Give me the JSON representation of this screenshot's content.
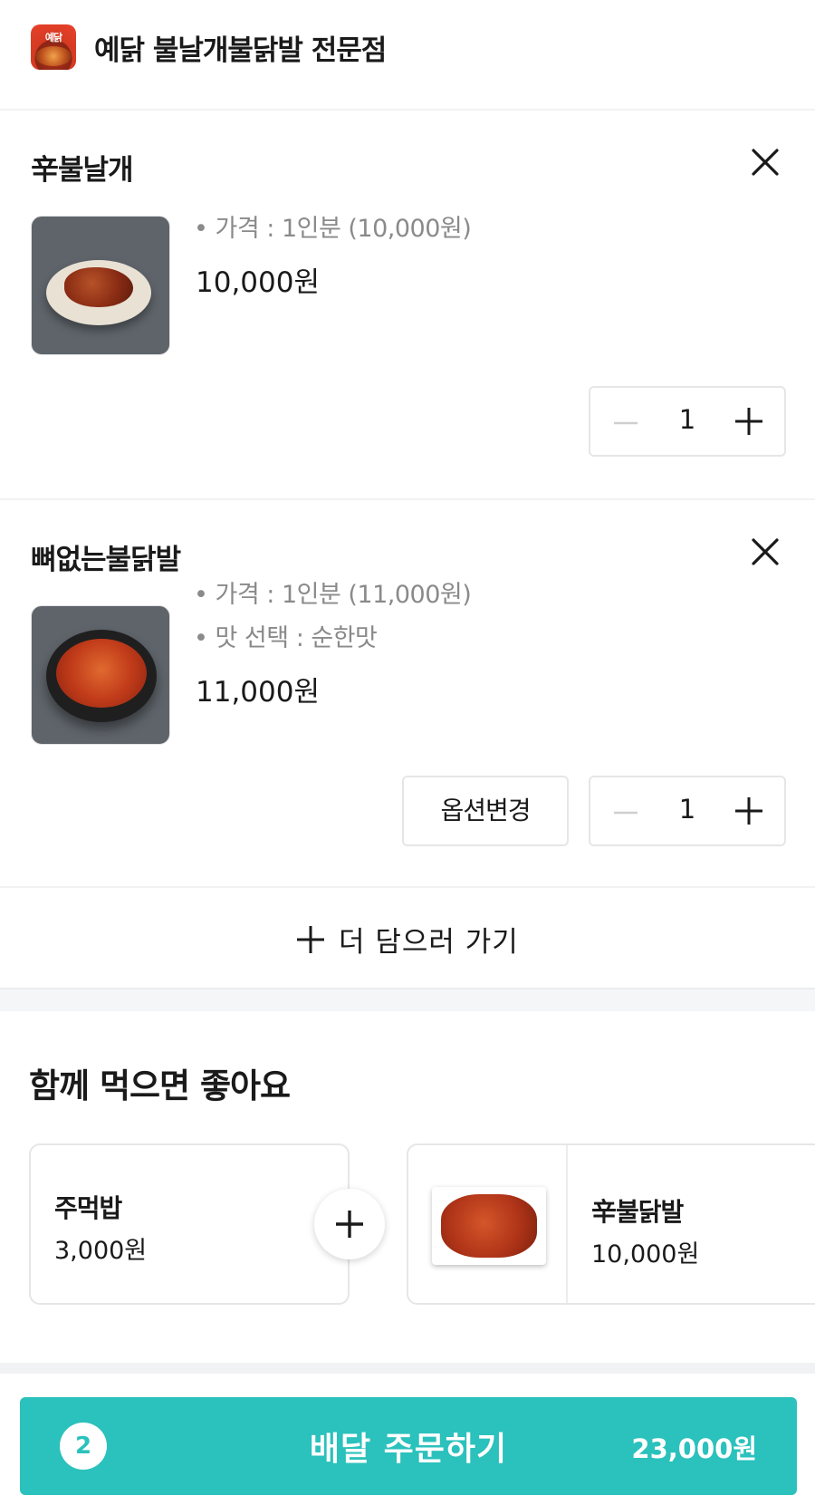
{
  "store": {
    "name": "예닭 불날개불닭발 전문점",
    "logo_text": "예닭"
  },
  "cart": {
    "items": [
      {
        "name": "辛불날개",
        "options": [
          "• 가격 : 1인분 (10,000원)"
        ],
        "price": "10,000원",
        "quantity": "1"
      },
      {
        "name": "뼈없는불닭발",
        "options": [
          "• 가격 : 1인분 (11,000원)",
          "• 맛 선택 : 순한맛"
        ],
        "price": "11,000원",
        "quantity": "1",
        "option_change_label": "옵션변경"
      }
    ],
    "add_more_label": "더 담으러 가기"
  },
  "recommend": {
    "title": "함께 먹으면 좋아요",
    "items": [
      {
        "name": "주먹밥",
        "price": "3,000원"
      },
      {
        "name": "辛불닭발",
        "price": "10,000원"
      }
    ]
  },
  "order_bar": {
    "count": "2",
    "label": "배달 주문하기",
    "total": "23,000원",
    "color": "#2bc1bc"
  }
}
